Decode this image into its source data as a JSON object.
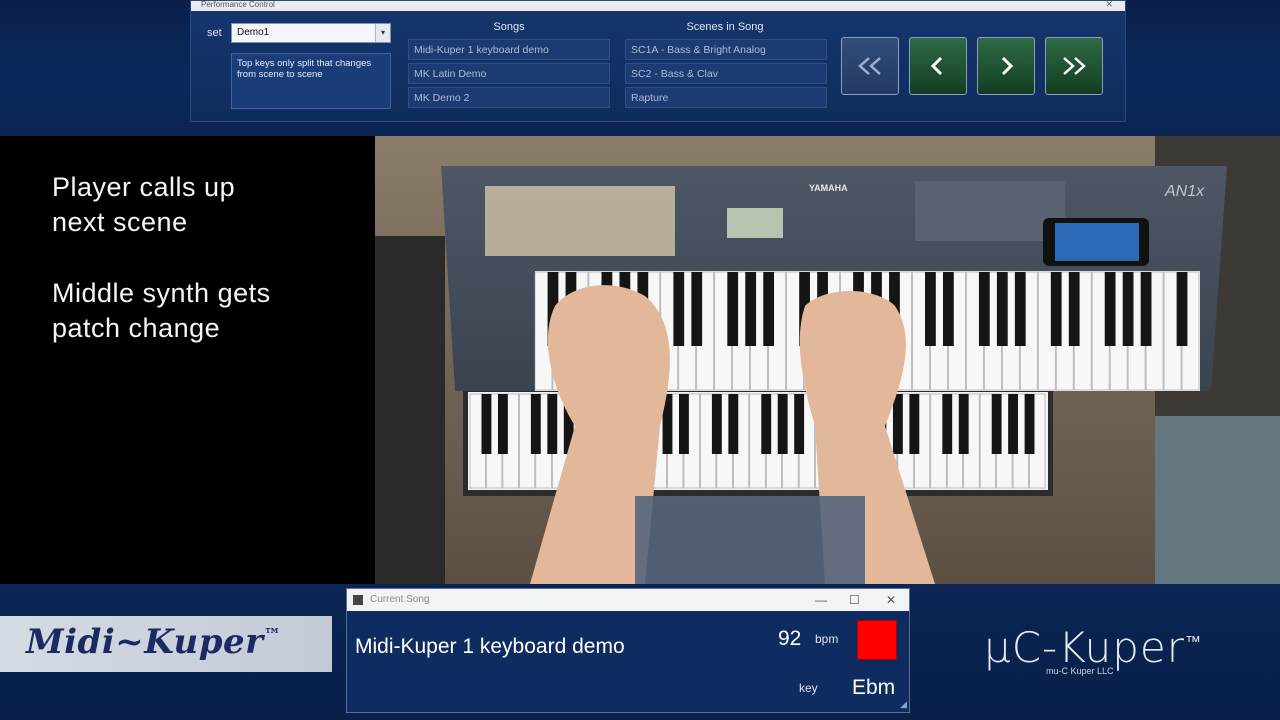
{
  "performance_window": {
    "title": "Performance Control",
    "close_glyph": "✕",
    "set_label": "set",
    "set_value": "Demo1",
    "set_arrow": "▾",
    "set_note": "Top keys only split that changes from scene to scene",
    "songs_header": "Songs",
    "songs": [
      {
        "label": "Midi-Kuper 1 keyboard demo",
        "selected": true
      },
      {
        "label": "MK Latin Demo",
        "selected": false
      },
      {
        "label": "MK Demo 2",
        "selected": false
      }
    ],
    "scenes_header": "Scenes in Song",
    "scenes": [
      {
        "label": "SC1A - Bass & Bright Analog",
        "selected": true
      },
      {
        "label": "SC2 - Bass & Clav",
        "selected": false
      },
      {
        "label": "Rapture",
        "selected": false
      }
    ],
    "nav_buttons": [
      {
        "icon": "double-chevron-left-icon",
        "enabled": false
      },
      {
        "icon": "chevron-left-icon",
        "enabled": true
      },
      {
        "icon": "chevron-right-icon",
        "enabled": true
      },
      {
        "icon": "double-chevron-right-icon",
        "enabled": true
      }
    ]
  },
  "caption": {
    "line1": "Player calls up",
    "line2": "next scene",
    "line3": "Middle synth gets",
    "line4": "patch change"
  },
  "video": {
    "synth_brand": "YAMAHA",
    "synth_model": "AN1x"
  },
  "logo_left": {
    "text": "Midi~Kuper",
    "tm": "™"
  },
  "current_song_window": {
    "title": "Current Song",
    "minimize": "—",
    "maximize": "☐",
    "close": "✕",
    "song_name": "Midi-Kuper 1 keyboard demo",
    "bpm_value": "92",
    "bpm_label": "bpm",
    "beat_color": "#ff0000",
    "key_label": "key",
    "key_value": "Ebm"
  },
  "logo_right": {
    "text": "μC-Kuper",
    "tm": "™",
    "sub": "mu-C Kuper LLC"
  }
}
